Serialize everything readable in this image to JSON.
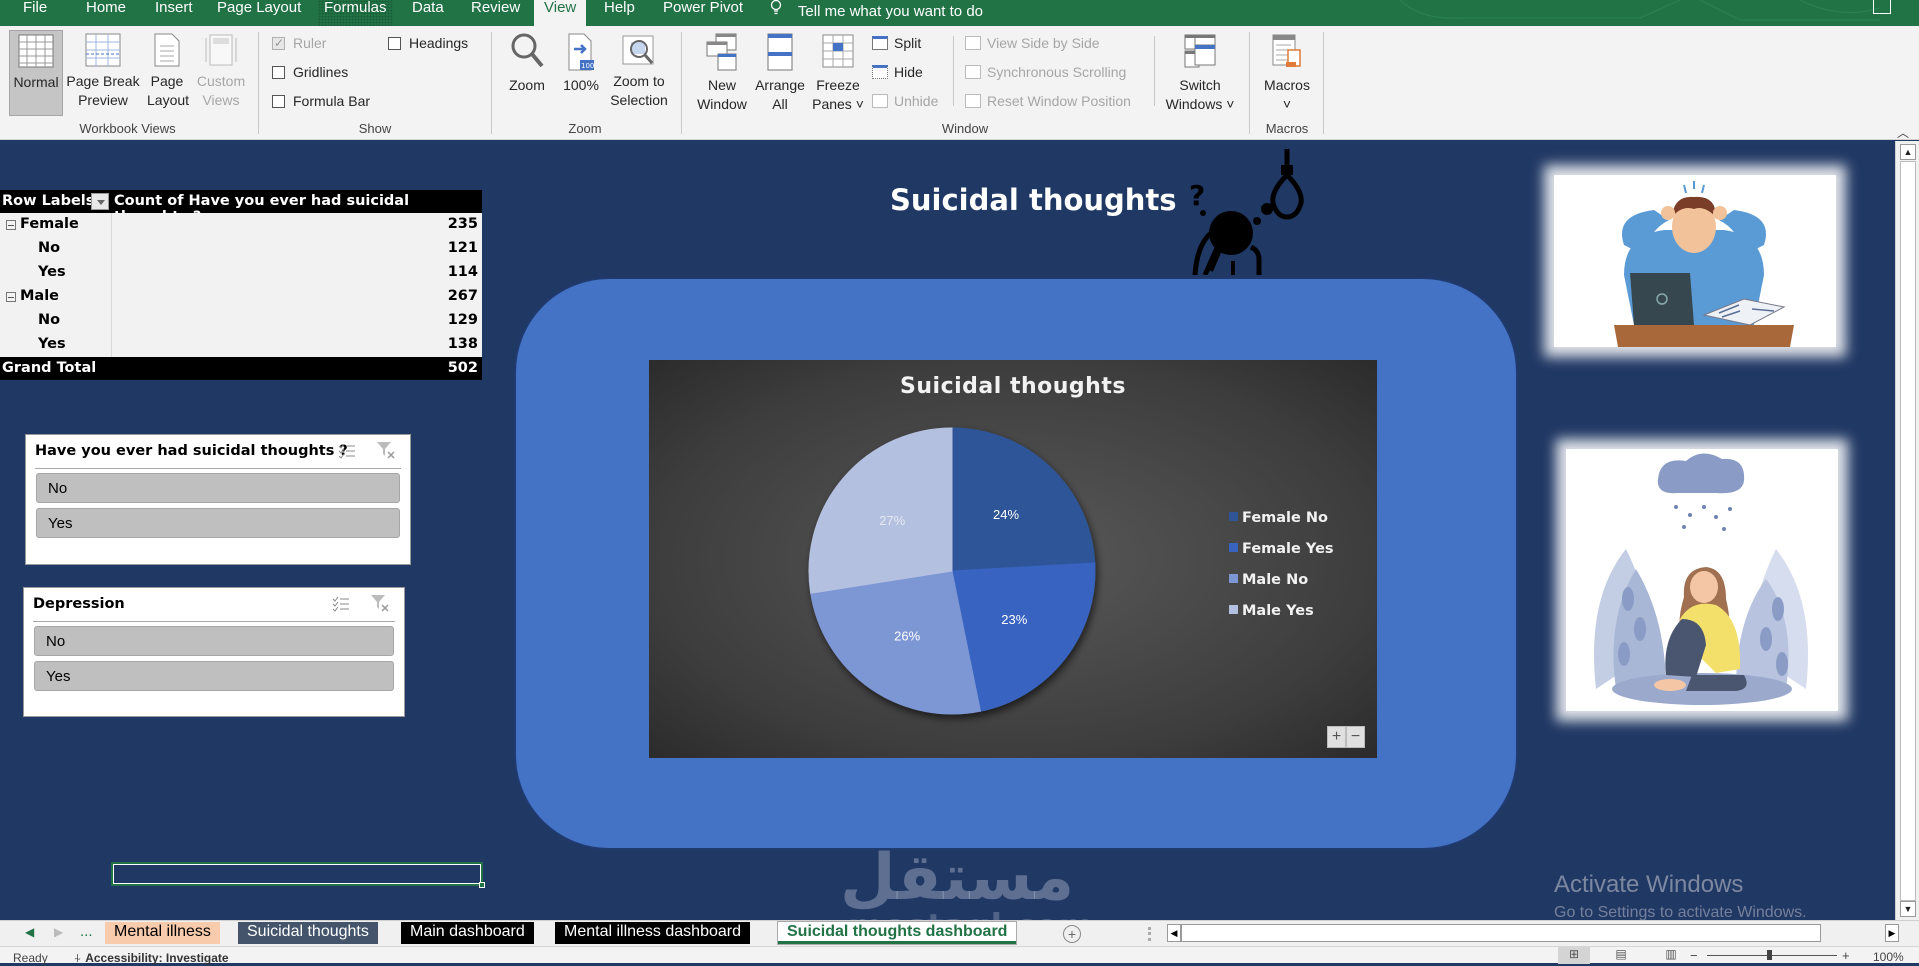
{
  "menu": {
    "tabs": [
      "File",
      "Home",
      "Insert",
      "Page Layout",
      "Formulas",
      "Data",
      "Review",
      "View",
      "Help",
      "Power Pivot"
    ],
    "active_tab": "View",
    "tell_me": "Tell me what you want to do"
  },
  "ribbon": {
    "workbook_views": {
      "label": "Workbook Views",
      "normal": "Normal",
      "page_break_1": "Page Break",
      "page_break_2": "Preview",
      "page_layout_1": "Page",
      "page_layout_2": "Layout",
      "custom_1": "Custom",
      "custom_2": "Views"
    },
    "show": {
      "label": "Show",
      "ruler": "Ruler",
      "gridlines": "Gridlines",
      "formula_bar": "Formula Bar",
      "headings": "Headings"
    },
    "zoom": {
      "label": "Zoom",
      "zoom": "Zoom",
      "hundred": "100%",
      "zoom_sel_1": "Zoom to",
      "zoom_sel_2": "Selection",
      "badge": "100"
    },
    "window": {
      "label": "Window",
      "new_1": "New",
      "new_2": "Window",
      "arrange_1": "Arrange",
      "arrange_2": "All",
      "freeze_1": "Freeze",
      "freeze_2": "Panes ˅",
      "split": "Split",
      "hide": "Hide",
      "unhide": "Unhide",
      "side_by_side": "View Side by Side",
      "sync_scroll": "Synchronous Scrolling",
      "reset_pos": "Reset Window Position",
      "switch_1": "Switch",
      "switch_2": "Windows ˅"
    },
    "macros": {
      "label": "Macros",
      "button": "Macros",
      "chevron": "˅"
    }
  },
  "pivot": {
    "header_row_labels": "Row Labels",
    "header_value": "Count of Have you ever had suicidal thoughts ?",
    "rows": [
      {
        "label": "Female",
        "value": "235",
        "level": 0
      },
      {
        "label": "No",
        "value": "121",
        "level": 1
      },
      {
        "label": "Yes",
        "value": "114",
        "level": 1
      },
      {
        "label": "Male",
        "value": "267",
        "level": 0
      },
      {
        "label": "No",
        "value": "129",
        "level": 1
      },
      {
        "label": "Yes",
        "value": "138",
        "level": 1
      }
    ],
    "grand_total_label": "Grand Total",
    "grand_total_value": "502"
  },
  "slicers": [
    {
      "title": "Have you ever had suicidal thoughts ?",
      "items": [
        "No",
        "Yes"
      ]
    },
    {
      "title": "Depression",
      "items": [
        "No",
        "Yes"
      ]
    }
  ],
  "dashboard": {
    "title": "Suicidal thoughts"
  },
  "chart_data": {
    "type": "pie",
    "title": "Suicidal thoughts",
    "categories": [
      "Female No",
      "Female Yes",
      "Male No",
      "Male Yes"
    ],
    "values": [
      121,
      114,
      129,
      138
    ],
    "labels": [
      "24%",
      "23%",
      "26%",
      "27%"
    ],
    "colors": [
      "#2f5597",
      "#3864c0",
      "#7d96d4",
      "#b4c0e0"
    ],
    "label_colors": [
      "#ffffff",
      "#ffffff",
      "#ffffff",
      "#e6e9f2"
    ],
    "legend_position": "right",
    "zoom_plus": "+",
    "zoom_minus": "−"
  },
  "watermark": {
    "arabic": "مستقل",
    "latin": "mostaql.com"
  },
  "activation": {
    "line1": "Activate Windows",
    "line2": "Go to Settings to activate Windows."
  },
  "sheet_tabs": {
    "ellipsis": "...",
    "tabs": [
      {
        "label": "Mental illness",
        "bg": "#f8cbad",
        "fg": "#000000"
      },
      {
        "label": "Suicidal thoughts",
        "bg": "#44546a",
        "fg": "#ffffff"
      },
      {
        "label": "Main dashboard",
        "bg": "#000000",
        "fg": "#ffffff"
      },
      {
        "label": "Mental illness dashboard",
        "bg": "#000000",
        "fg": "#ffffff"
      },
      {
        "label": "Suicidal thoughts dashboard",
        "bg": "#ffffff",
        "fg": "#217346",
        "active": true
      }
    ],
    "add": "+"
  },
  "status": {
    "ready": "Ready",
    "accessibility": "Accessibility: Investigate",
    "zoom": "100%"
  }
}
